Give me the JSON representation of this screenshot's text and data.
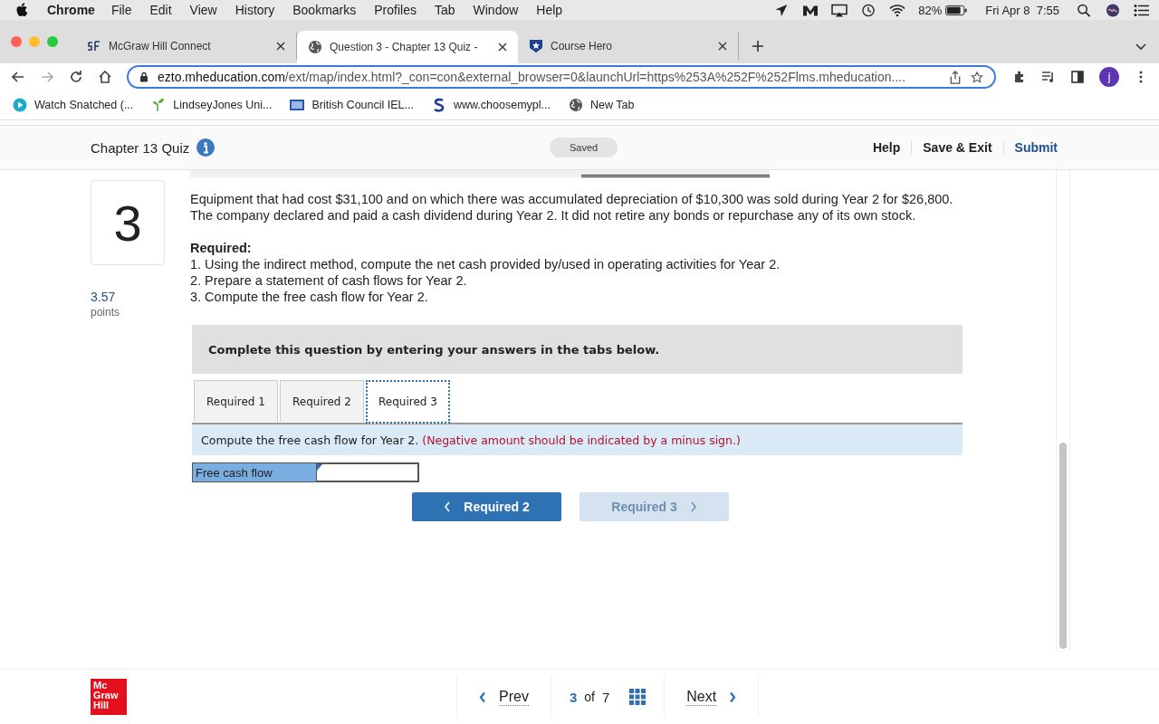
{
  "menubar": {
    "app": "Chrome",
    "menus": [
      "File",
      "Edit",
      "View",
      "History",
      "Bookmarks",
      "Profiles",
      "Tab",
      "Window",
      "Help"
    ],
    "battery": "82%",
    "clock": "Fri Apr 8  7:55"
  },
  "browser_tabs": [
    {
      "title": "McGraw Hill Connect",
      "kind": "sf",
      "selected": false
    },
    {
      "title": "Question 3 - Chapter 13 Quiz -",
      "kind": "globe",
      "selected": true
    },
    {
      "title": "Course Hero",
      "kind": "star",
      "selected": false
    }
  ],
  "toolbar": {
    "url_host": "ezto.mheducation.com",
    "url_path": "/ext/map/index.html?_con=con&external_browser=0&launchUrl=https%253A%252F%252Flms.mheducation....",
    "avatar": "j"
  },
  "bookmarks": [
    {
      "label": "Watch Snatched (...",
      "kind": "play"
    },
    {
      "label": "LindseyJones Uni...",
      "kind": "sprout"
    },
    {
      "label": "British Council IEL...",
      "kind": "ors"
    },
    {
      "label": "www.choosemypl...",
      "kind": "s"
    },
    {
      "label": "New Tab",
      "kind": "globe"
    }
  ],
  "quiz_header": {
    "title": "Chapter 13 Quiz",
    "status": "Saved",
    "links": [
      "Help",
      "Save & Exit",
      "Submit"
    ]
  },
  "question": {
    "number": "3",
    "points": "3.57",
    "points_label": "points",
    "paragraphs": [
      "Equipment that had cost $31,100 and on which there was accumulated depreciation of $10,300 was sold during Year 2 for $26,800.",
      "The company declared and paid a cash dividend during Year 2. It did not retire any bonds or repurchase any of its own stock."
    ],
    "required_heading": "Required:",
    "required_items": [
      "1. Using the indirect method, compute the net cash provided by/used in operating activities for Year 2.",
      "2. Prepare a statement of cash flows for Year 2.",
      "3. Compute the free cash flow for Year 2."
    ],
    "instructions": "Complete this question by entering your answers in the tabs below.",
    "tabs": [
      {
        "label": "Required 1",
        "selected": false
      },
      {
        "label": "Required 2",
        "selected": false
      },
      {
        "label": "Required 3",
        "selected": true
      }
    ],
    "prompt": "Compute the free cash flow for Year 2.",
    "prompt_note": "(Negative amount should be indicated by a minus sign.)",
    "answer_label": "Free cash flow",
    "nav_buttons": [
      {
        "label": "Required 2",
        "kind": "prev",
        "disabled": false
      },
      {
        "label": "Required 3",
        "kind": "next",
        "disabled": true
      }
    ]
  },
  "footer": {
    "logo": [
      "Mc",
      "Graw",
      "Hill"
    ],
    "prev": "Prev",
    "current": "3",
    "of": "of",
    "total": "7",
    "next": "Next"
  }
}
